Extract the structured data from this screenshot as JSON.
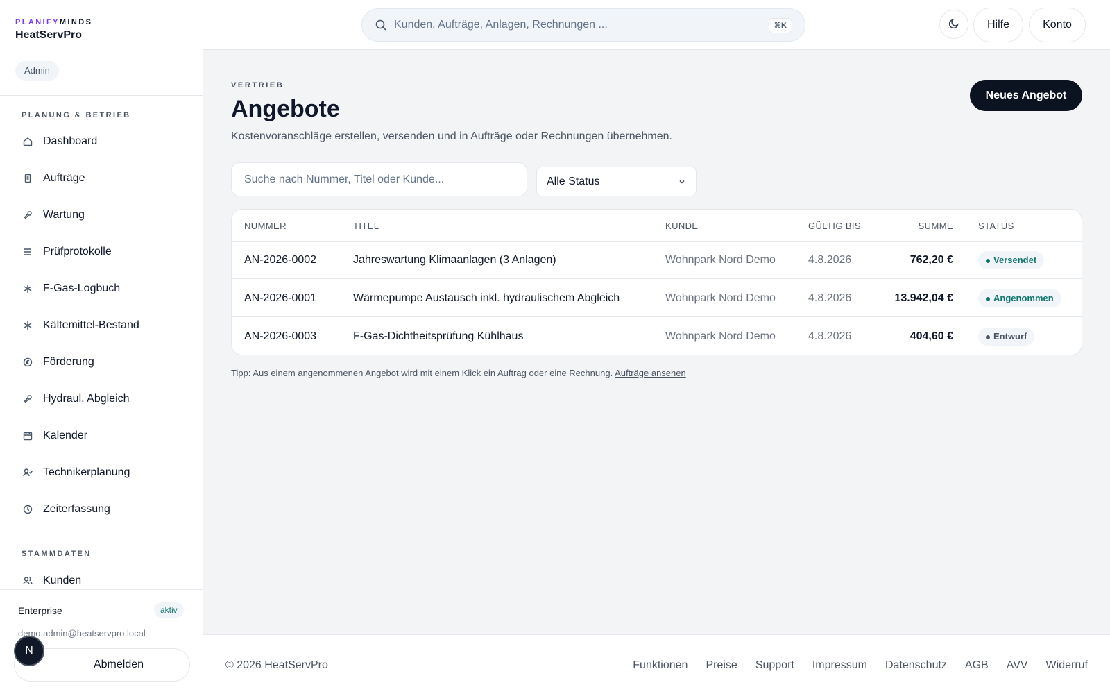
{
  "brand": {
    "prefix": "PLANIFY",
    "suffix": "MINDS",
    "app_name": "HeatServPro",
    "role": "Admin"
  },
  "sidebar": {
    "sections": [
      {
        "label": "PLANUNG & BETRIEB"
      },
      {
        "label": "STAMMDATEN"
      }
    ],
    "items": [
      {
        "label": "Dashboard",
        "icon": "home-icon"
      },
      {
        "label": "Aufträge",
        "icon": "clipboard-icon"
      },
      {
        "label": "Wartung",
        "icon": "wrench-icon"
      },
      {
        "label": "Prüfprotokolle",
        "icon": "list-check-icon"
      },
      {
        "label": "F-Gas-Logbuch",
        "icon": "snowflake-icon"
      },
      {
        "label": "Kältemittel-Bestand",
        "icon": "snowflake-icon"
      },
      {
        "label": "Förderung",
        "icon": "euro-circle-icon"
      },
      {
        "label": "Hydraul. Abgleich",
        "icon": "wrench-icon"
      },
      {
        "label": "Kalender",
        "icon": "calendar-icon"
      },
      {
        "label": "Technikerplanung",
        "icon": "user-check-icon"
      },
      {
        "label": "Zeiterfassung",
        "icon": "clock-icon"
      },
      {
        "label": "Kunden",
        "icon": "users-icon"
      }
    ],
    "footer": {
      "plan": "Enterprise",
      "plan_status": "aktiv",
      "email": "demo.admin@heatservpro.local",
      "logout_label": "Abmelden",
      "avatar_initial": "N"
    }
  },
  "topbar": {
    "search_placeholder": "Kunden, Aufträge, Anlagen, Rechnungen ...",
    "shortcut": "⌘K",
    "help_label": "Hilfe",
    "account_label": "Konto"
  },
  "main": {
    "eyebrow": "VERTRIEB",
    "title": "Angebote",
    "subtitle": "Kostenvoranschläge erstellen, versenden und in Aufträge oder Rechnungen übernehmen.",
    "new_button": "Neues Angebot",
    "filter_placeholder": "Suche nach Nummer, Titel oder Kunde...",
    "status_filter": "Alle Status",
    "table": {
      "columns": [
        "NUMMER",
        "TITEL",
        "KUNDE",
        "GÜLTIG BIS",
        "SUMME",
        "STATUS"
      ],
      "rows": [
        {
          "number": "AN-2026-0002",
          "title": "Jahreswartung Klimaanlagen (3 Anlagen)",
          "customer": "Wohnpark Nord Demo",
          "valid_until": "4.8.2026",
          "sum": "762,20 €",
          "status": "Versendet"
        },
        {
          "number": "AN-2026-0001",
          "title": "Wärmepumpe Austausch inkl. hydraulischem Abgleich",
          "customer": "Wohnpark Nord Demo",
          "valid_until": "4.8.2026",
          "sum": "13.942,04 €",
          "status": "Angenommen"
        },
        {
          "number": "AN-2026-0003",
          "title": "F-Gas-Dichtheitsprüfung Kühlhaus",
          "customer": "Wohnpark Nord Demo",
          "valid_until": "4.8.2026",
          "sum": "404,60 €",
          "status": "Entwurf"
        }
      ]
    },
    "tip_text": "Tipp: Aus einem angenommenen Angebot wird mit einem Klick ein Auftrag oder eine Rechnung.",
    "tip_link": "Aufträge ansehen"
  },
  "footer": {
    "copyright": "© 2026 HeatServPro",
    "links": [
      "Funktionen",
      "Preise",
      "Support",
      "Impressum",
      "Datenschutz",
      "AGB",
      "AVV",
      "Widerruf"
    ]
  },
  "colors": {
    "accent": "#7c3aed",
    "primary": "#0b1220",
    "status_green": "#0f766e"
  }
}
